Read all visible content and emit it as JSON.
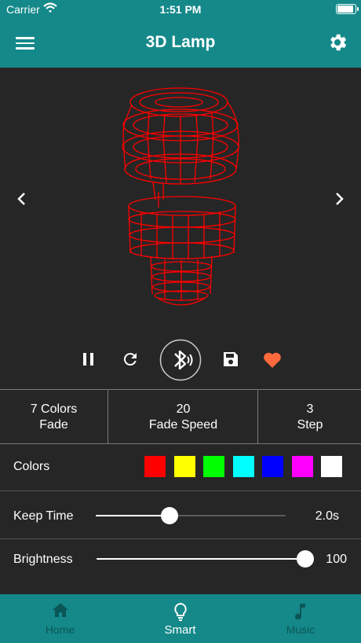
{
  "status_bar": {
    "carrier": "Carrier",
    "time": "1:51 PM"
  },
  "nav": {
    "title": "3D Lamp"
  },
  "lamp": {
    "color": "#ff0000"
  },
  "info": {
    "mode_value": "7 Colors",
    "mode_label": "Fade",
    "speed_value": "20",
    "speed_label": "Fade Speed",
    "step_value": "3",
    "step_label": "Step"
  },
  "colors": {
    "label": "Colors",
    "swatches": [
      "#ff0000",
      "#ffff00",
      "#00ff00",
      "#00ffff",
      "#0000ff",
      "#ff00ff",
      "#ffffff"
    ]
  },
  "keep_time": {
    "label": "Keep Time",
    "value_text": "2.0s",
    "level": 0.39
  },
  "brightness": {
    "label": "Brightness",
    "value_text": "100",
    "level": 1.0
  },
  "tabs": [
    {
      "label": "Home",
      "icon": "home-icon",
      "active": false
    },
    {
      "label": "Smart",
      "icon": "lightbulb-icon",
      "active": true
    },
    {
      "label": "Music",
      "icon": "music-note-icon",
      "active": false
    }
  ],
  "theme": {
    "accent": "#15898a",
    "background": "#262626",
    "heart": "#ff6a3d"
  }
}
